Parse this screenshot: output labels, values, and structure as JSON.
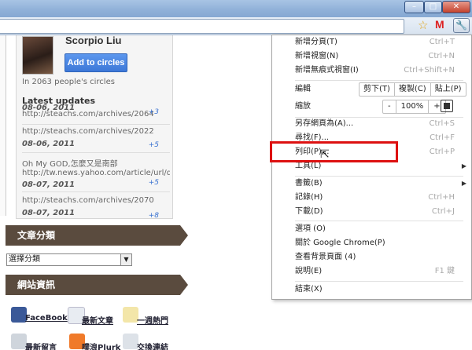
{
  "window": {
    "minimize_icon": "minimize-icon",
    "maximize_icon": "maximize-icon",
    "close_icon": "close-icon",
    "minimize_glyph": "–",
    "maximize_glyph": "□",
    "close_glyph": "✕"
  },
  "toolbar": {
    "star_glyph": "☆",
    "gmail_glyph": "M",
    "wrench_glyph": "🔧"
  },
  "profile": {
    "name": "Scorpio Liu",
    "add_button": "Add to circles",
    "circle_count": "In 2063 people's circles",
    "latest_title": "Latest updates",
    "updates": [
      {
        "url": "http://steachs.com/archives/2064",
        "date": "08-06, 2011",
        "count": "+3"
      },
      {
        "url": "http://steachs.com/archives/2022",
        "date": "08-06, 2011",
        "count": "+5"
      },
      {
        "url_line1": "Oh My GOD,怎麼又是南部",
        "url": "http://tw.news.yahoo.com/article/url/d/a",
        "date": "08-07, 2011",
        "count": "+5"
      },
      {
        "url": "http://steachs.com/archives/2070",
        "date": "08-07, 2011",
        "count": "+8"
      }
    ]
  },
  "sidebar": {
    "category_header": "文章分類",
    "category_select": "選擇分類",
    "info_header": "網站資訊",
    "links": [
      "FaceBook",
      "最新文章",
      "一週熱門",
      "最新留言",
      "噗浪Plurk",
      "交換連結"
    ]
  },
  "menu": {
    "new_tab": {
      "label": "新增分頁(T)",
      "key": "Ctrl+T"
    },
    "new_window": {
      "label": "新增視窗(N)",
      "key": "Ctrl+N"
    },
    "incognito": {
      "label": "新增無痕式視窗(I)",
      "key": "Ctrl+Shift+N"
    },
    "edit": {
      "label": "編輯",
      "cut": "剪下(T)",
      "copy": "複製(C)",
      "paste": "貼上(P)"
    },
    "zoom": {
      "label": "縮放",
      "minus": "-",
      "level": "100%",
      "plus": "+"
    },
    "save_as": {
      "label": "另存網頁為(A)...",
      "key": "Ctrl+S"
    },
    "find": {
      "label": "尋找(F)...",
      "key": "Ctrl+F"
    },
    "print": {
      "label": "列印(P)...",
      "key": "Ctrl+P"
    },
    "tools": {
      "label": "工具(L)"
    },
    "bookmarks": {
      "label": "書籤(B)"
    },
    "history": {
      "label": "記錄(H)",
      "key": "Ctrl+H"
    },
    "downloads": {
      "label": "下載(D)",
      "key": "Ctrl+J"
    },
    "options": {
      "label": "選項 (O)"
    },
    "about": {
      "label": "關於 Google Chrome(P)"
    },
    "background_pages": {
      "label": "查看背景頁面 (4)"
    },
    "help": {
      "label": "說明(E)",
      "key": "F1 鍵"
    },
    "exit": {
      "label": "結束(X)"
    },
    "submenu_arrow": "▶"
  },
  "colors": {
    "highlight": "#dd1111",
    "accent": "#3d78d8",
    "header_bg": "#5a4b3e"
  }
}
